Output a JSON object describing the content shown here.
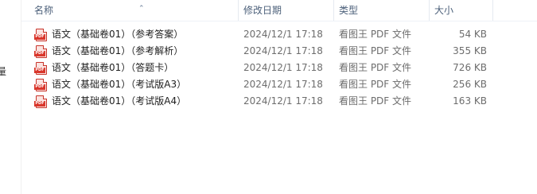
{
  "columns": {
    "name": "名称",
    "date": "修改日期",
    "type": "类型",
    "size": "大小"
  },
  "sort": {
    "column": "name",
    "direction": "ascending",
    "icon": "sort-caret-up-icon"
  },
  "nav_pane": {
    "partial_glyph": "量"
  },
  "files": [
    {
      "name": "语文（基础卷01）（参考答案）",
      "date": "2024/12/1 17:18",
      "type": "看图王 PDF 文件",
      "size": "54 KB",
      "icon": "pdf-icon"
    },
    {
      "name": "语文（基础卷01）（参考解析）",
      "date": "2024/12/1 17:18",
      "type": "看图王 PDF 文件",
      "size": "355 KB",
      "icon": "pdf-icon"
    },
    {
      "name": "语文（基础卷01）（答题卡）",
      "date": "2024/12/1 17:18",
      "type": "看图王 PDF 文件",
      "size": "726 KB",
      "icon": "pdf-icon"
    },
    {
      "name": "语文（基础卷01）（考试版A3）",
      "date": "2024/12/1 17:18",
      "type": "看图王 PDF 文件",
      "size": "256 KB",
      "icon": "pdf-icon"
    },
    {
      "name": "语文（基础卷01）（考试版A4）",
      "date": "2024/12/1 17:18",
      "type": "看图王 PDF 文件",
      "size": "163 KB",
      "icon": "pdf-icon"
    }
  ],
  "colors": {
    "header_text": "#4c607a",
    "secondary_text": "#6d6d6d",
    "pdf_red": "#d9362b"
  }
}
